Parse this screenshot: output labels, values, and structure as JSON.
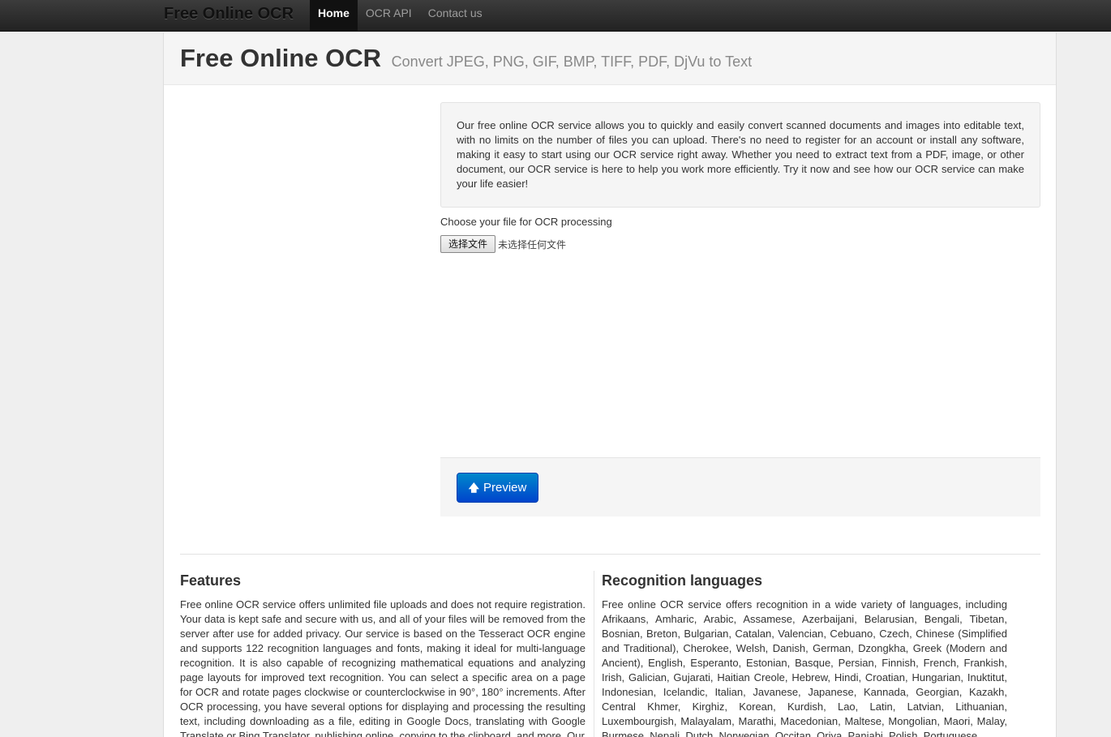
{
  "navbar": {
    "brand": "Free Online OCR",
    "items": [
      {
        "label": "Home",
        "active": true
      },
      {
        "label": "OCR API",
        "active": false
      },
      {
        "label": "Contact us",
        "active": false
      }
    ]
  },
  "hero": {
    "title": "Free Online OCR",
    "subtitle": "Convert JPEG, PNG, GIF, BMP, TIFF, PDF, DjVu to Text"
  },
  "intro": {
    "text": "Our free online OCR service allows you to quickly and easily convert scanned documents and images into editable text, with no limits on the number of files you can upload. There's no need to register for an account or install any software, making it easy to start using our OCR service right away. Whether you need to extract text from a PDF, image, or other document, our OCR service is here to help you work more efficiently. Try it now and see how our OCR service can make your life easier!"
  },
  "upload": {
    "label": "Choose your file for OCR processing",
    "button_label": "选择文件",
    "status": "未选择任何文件"
  },
  "actions": {
    "preview_label": "Preview",
    "preview_icon": "arrow-up-icon"
  },
  "features": {
    "heading": "Features",
    "text": "Free online OCR service offers unlimited file uploads and does not require registration. Your data is kept safe and secure with us, and all of your files will be removed from the server after use for added privacy. Our service is based on the Tesseract OCR engine and supports 122 recognition languages and fonts, making it ideal for multi-language recognition. It is also capable of recognizing mathematical equations and analyzing page layouts for improved text recognition. You can select a specific area on a page for OCR and rotate pages clockwise or counterclockwise in 90°, 180° increments. After OCR processing, you have several options for displaying and processing the resulting text, including downloading as a file, editing in Google Docs, translating with Google Translate or Bing Translator, publishing online, copying to the clipboard, and more. Our"
  },
  "languages": {
    "heading": "Recognition languages",
    "text": "Free online OCR service offers recognition in a wide variety of languages, including Afrikaans, Amharic, Arabic, Assamese, Azerbaijani, Belarusian, Bengali, Tibetan, Bosnian, Breton, Bulgarian, Catalan, Valencian, Cebuano, Czech, Chinese (Simplified and Traditional), Cherokee, Welsh, Danish, German, Dzongkha, Greek (Modern and Ancient), English, Esperanto, Estonian, Basque, Persian, Finnish, French, Frankish, Irish, Galician, Gujarati, Haitian Creole, Hebrew, Hindi, Croatian, Hungarian, Inuktitut, Indonesian, Icelandic, Italian, Javanese, Japanese, Kannada, Georgian, Kazakh, Central Khmer, Kirghiz, Korean, Kurdish, Lao, Latin, Latvian, Lithuanian, Luxembourgish, Malayalam, Marathi, Macedonian, Maltese, Mongolian, Maori, Malay, Burmese, Nepali, Dutch, Norwegian, Occitan, Oriya, Panjabi, Polish, Portuguese,"
  }
}
